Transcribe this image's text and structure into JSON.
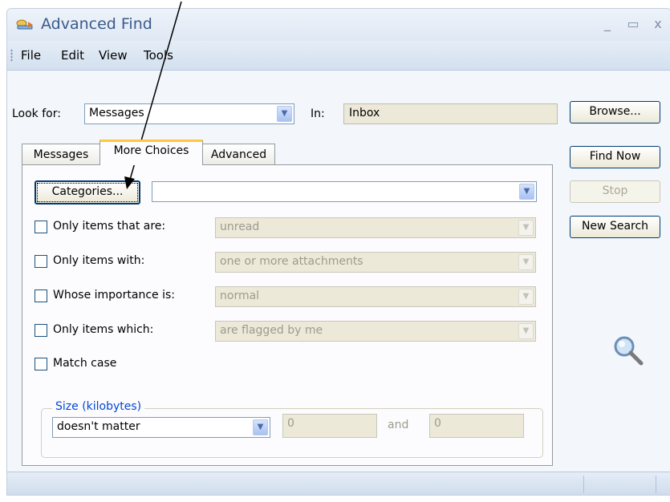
{
  "window": {
    "title": "Advanced Find",
    "minimize_label": "_",
    "maximize_label": "▭",
    "close_label": "x"
  },
  "menu": {
    "file": "File",
    "edit": "Edit",
    "view": "View",
    "tools": "Tools"
  },
  "look_for": {
    "label": "Look for:",
    "value": "Messages"
  },
  "in": {
    "label": "In:",
    "value": "Inbox"
  },
  "buttons": {
    "browse": "Browse...",
    "find_now": "Find Now",
    "stop": "Stop",
    "new_search": "New Search",
    "categories": "Categories..."
  },
  "tabs": [
    "Messages",
    "More Choices",
    "Advanced"
  ],
  "categories_value": "",
  "options": [
    {
      "label": "Only items that are:",
      "value": "unread",
      "checked": false
    },
    {
      "label": "Only items with:",
      "value": "one or more attachments",
      "checked": false
    },
    {
      "label": "Whose importance is:",
      "value": "normal",
      "checked": false
    },
    {
      "label": "Only items which:",
      "value": "are flagged by me",
      "checked": false
    }
  ],
  "match_case": {
    "label": "Match case",
    "checked": false
  },
  "size": {
    "group_label": "Size (kilobytes)",
    "condition": "doesn't matter",
    "from": "0",
    "and_label": "and",
    "to": "0"
  },
  "colors": {
    "accent": "#0046d5",
    "tab_highlight": "#ffc83c",
    "title_text": "#3a5a8c"
  }
}
